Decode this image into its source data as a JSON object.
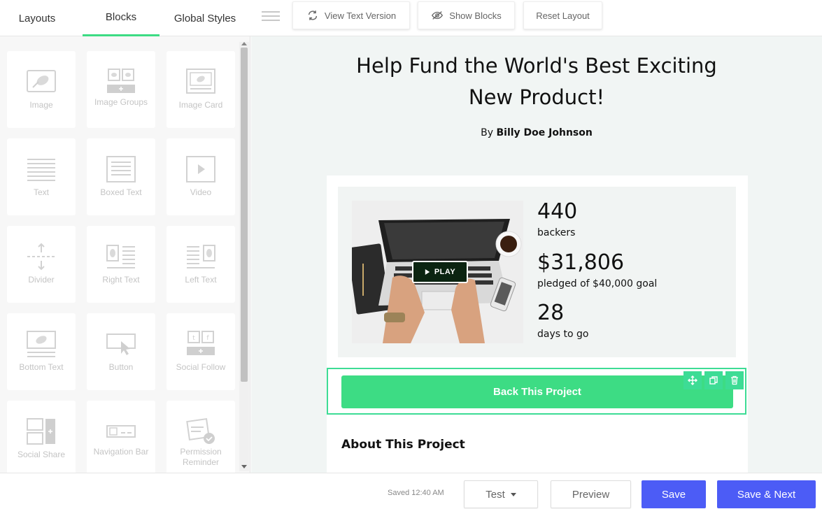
{
  "topbar": {
    "tabs": [
      {
        "label": "Layouts"
      },
      {
        "label": "Blocks"
      },
      {
        "label": "Global Styles"
      }
    ],
    "buttons": {
      "view_text": "View Text Version",
      "show_blocks": "Show Blocks",
      "reset_layout": "Reset Layout"
    }
  },
  "sidebar": {
    "blocks": [
      {
        "label": "Image",
        "icon": "image-icon"
      },
      {
        "label": "Image Groups",
        "icon": "image-groups-icon"
      },
      {
        "label": "Image Card",
        "icon": "image-card-icon"
      },
      {
        "label": "Text",
        "icon": "text-icon"
      },
      {
        "label": "Boxed Text",
        "icon": "boxed-text-icon"
      },
      {
        "label": "Video",
        "icon": "video-icon"
      },
      {
        "label": "Divider",
        "icon": "divider-icon"
      },
      {
        "label": "Right Text",
        "icon": "right-text-icon"
      },
      {
        "label": "Left Text",
        "icon": "left-text-icon"
      },
      {
        "label": "Bottom Text",
        "icon": "bottom-text-icon"
      },
      {
        "label": "Button",
        "icon": "button-icon"
      },
      {
        "label": "Social Follow",
        "icon": "social-follow-icon"
      },
      {
        "label": "Social Share",
        "icon": "social-share-icon"
      },
      {
        "label": "Navigation Bar",
        "icon": "navigation-bar-icon"
      },
      {
        "label": "Permission Reminder",
        "icon": "permission-reminder-icon"
      }
    ]
  },
  "canvas": {
    "headline": "Help Fund the World's Best Exciting New Product!",
    "byline_prefix": "By",
    "author": "Billy Doe Johnson",
    "play_label": "PLAY",
    "stats": [
      {
        "value": "440",
        "label": "backers"
      },
      {
        "value": "$31,806",
        "label": "pledged of $40,000 goal"
      },
      {
        "value": "28",
        "label": "days to go"
      }
    ],
    "cta_label": "Back This Project",
    "about_heading": "About This Project"
  },
  "bottombar": {
    "saved_text": "Saved 12:40 AM",
    "test_label": "Test",
    "preview_label": "Preview",
    "save_label": "Save",
    "save_next_label": "Save & Next"
  },
  "colors": {
    "accent_green": "#3ddc84",
    "primary_blue": "#4c5cf6"
  }
}
